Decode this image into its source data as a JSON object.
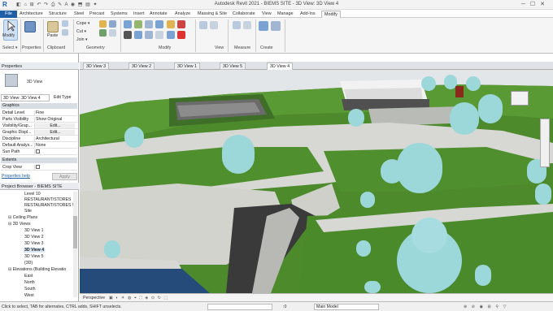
{
  "app": {
    "title": "Autodesk Revit 2021 - BIEMS SITE - 3D View: 3D View 4",
    "logo": "R",
    "quick_access": "◧ ⌂ ⊞ ↶ ↷ ⎙ ✎ A ◉ ⬒ ▤ ✦"
  },
  "ribbon_tabs": [
    "File",
    "Architecture",
    "Structure",
    "Steel",
    "Precast",
    "Systems",
    "Insert",
    "Annotate",
    "Analyze",
    "Massing & Site",
    "Collaborate",
    "View",
    "Manage",
    "Add-Ins",
    "Modify"
  ],
  "ribbon": {
    "modify_label": "Modify",
    "select_label": "Select ▾",
    "properties_label": "Properties",
    "paste_label": "Paste",
    "clipboard_label": "Clipboard",
    "geometry_label": "Geometry",
    "modify_group_label": "Modify",
    "view_label": "View",
    "measure_label": "Measure",
    "create_label": "Create",
    "cope": "Cope ▾",
    "cut": "Cut ▾",
    "join": "Join ▾"
  },
  "properties": {
    "header": "Properties",
    "type_name": "3D View",
    "instance_selector": "3D View: 3D View 4",
    "edit_type": "Edit Type",
    "sections": [
      "Graphics",
      "Extents"
    ],
    "rows": [
      {
        "k": "Detail Level",
        "v": "Fine"
      },
      {
        "k": "Parts Visibility",
        "v": "Show Original"
      },
      {
        "k": "Visibility/Grap...",
        "v": "Edit..."
      },
      {
        "k": "Graphic Displ...",
        "v": "Edit..."
      },
      {
        "k": "Discipline",
        "v": "Architectural"
      },
      {
        "k": "Default Analys...",
        "v": "None"
      },
      {
        "k": "Sun Path",
        "v": ""
      }
    ],
    "crop_view": "Crop View",
    "help": "Properties help",
    "apply": "Apply"
  },
  "project_browser": {
    "header": "Project Browser - BIEMS SITE",
    "items": [
      "Level 10",
      "RESTAURANT/STORES",
      "RESTAURANT/STORES W",
      "Site",
      "⊟ Ceiling Plans",
      "⊟ 3D Views",
      "3D View 1",
      "3D View 2",
      "3D View 3",
      "3D View 4",
      "3D View 5",
      "{3D}",
      "⊟ Elevations (Building Elevatio",
      "East",
      "North",
      "South",
      "West"
    ]
  },
  "view_tabs": [
    "3D View 3",
    "3D View 2",
    "3D View 1",
    "3D View 5",
    "3D View 4"
  ],
  "view_control": {
    "mode": "Perspective",
    "icons": "▣ ◐ ☀ ◍ ⌖ ⛶ ◈ ⊙ ↻ ⬚"
  },
  "status": {
    "hint": "Click to select, TAB for alternates, CTRL adds, SHIFT unselects.",
    "model": "Main Model",
    "zero": ":0"
  },
  "colors": {
    "ribbon_blue": "#1f5fa8",
    "grass": "#4f8f2e",
    "tree": "#9cd7d9",
    "path": "#d7d8d3"
  }
}
